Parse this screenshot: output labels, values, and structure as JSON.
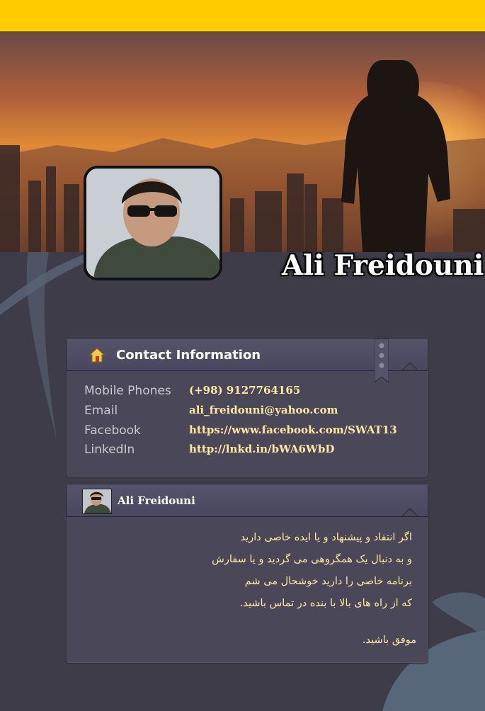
{
  "profile": {
    "name": "Ali Freidouni"
  },
  "contact": {
    "title": "Contact Information",
    "rows": [
      {
        "label": "Mobile Phones",
        "value": "(+98) 9127764165"
      },
      {
        "label": "Email",
        "value": "ali_freidouni@yahoo.com"
      },
      {
        "label": "Facebook",
        "value": "https://www.facebook.com/SWAT13"
      },
      {
        "label": "LinkedIn",
        "value": "http://lnkd.in/bWA6WbD"
      }
    ]
  },
  "comment": {
    "author": "Ali Freidouni",
    "message": "اگر انتقاد و  پیشنهاد و یا ایده خاصی دارید\nو به دنبال یک همگروهی می گردید و یا سفارش\nبرنامه خاصی را دارید خوشحال می شم\nکه از راه های بالا با بنده در تماس باشید.",
    "signoff": "موفق باشید."
  },
  "colors": {
    "top_bar": "#ffcc00",
    "background": "#3d3c48",
    "card": "#4a4858",
    "value_text": "#ffe8a0"
  },
  "icons": {
    "contact": "home-icon",
    "bookmark": "bookmark-icon"
  }
}
